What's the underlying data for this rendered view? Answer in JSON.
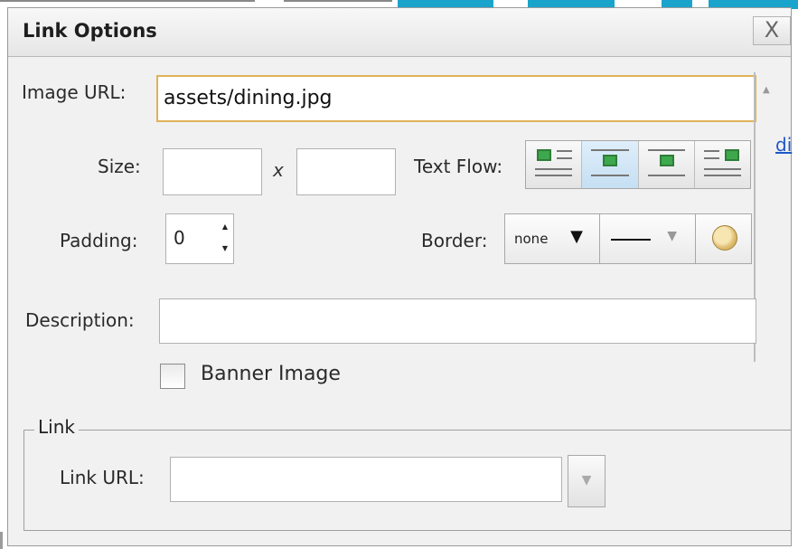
{
  "dialog": {
    "title": "Link Options",
    "close_label": "X"
  },
  "image_url": {
    "label": "Image URL:",
    "value": "assets/dining.jpg"
  },
  "size": {
    "label": "Size:",
    "separator": "x",
    "width_value": "",
    "height_value": ""
  },
  "text_flow": {
    "label": "Text Flow:",
    "options": [
      "wrap-left-icon",
      "inline-icon",
      "centered-icon",
      "wrap-right-icon"
    ],
    "selected_index": 1
  },
  "padding": {
    "label": "Padding:",
    "value": "0"
  },
  "border": {
    "label": "Border:",
    "style_value": "none",
    "line_style": "solid",
    "color_icon": "palette-icon"
  },
  "description": {
    "label": "Description:",
    "value": ""
  },
  "banner": {
    "label": "Banner Image",
    "checked": false
  },
  "link": {
    "legend": "Link",
    "url_label": "Link URL:",
    "url_value": ""
  },
  "background_peek": {
    "link_text": "di"
  },
  "colors": {
    "accent_cyan": "#1aa4cc",
    "focus_border": "#e0b25a",
    "link_blue": "#1d58c8"
  }
}
